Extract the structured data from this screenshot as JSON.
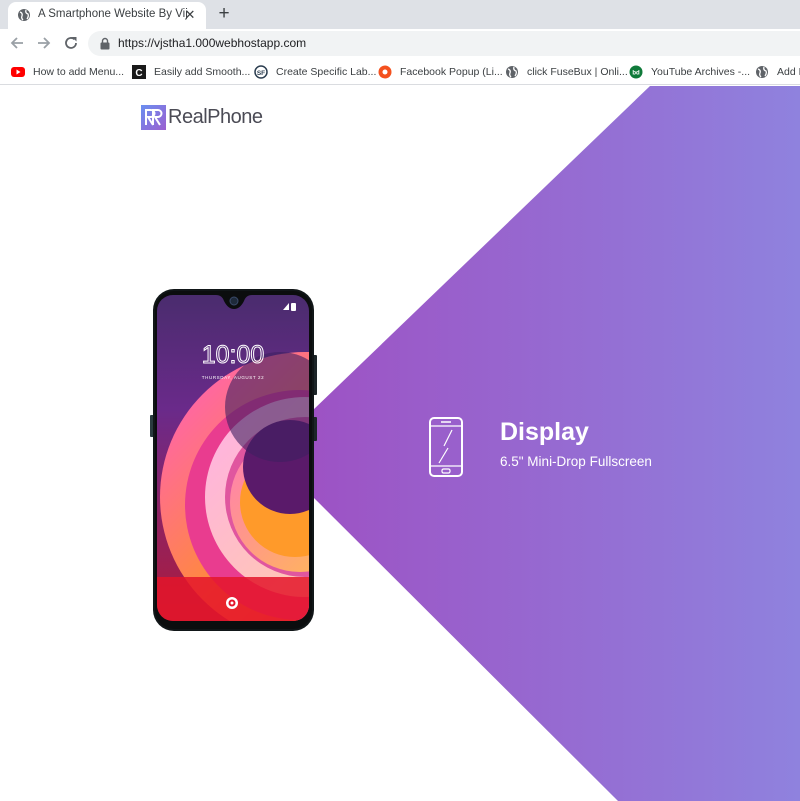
{
  "browser": {
    "tab_title": "A Smartphone Website By Vijay",
    "url": "https://vjstha1.000webhostapp.com",
    "bookmarks": [
      {
        "label": "How to add Menu...",
        "icon": "youtube-icon"
      },
      {
        "label": "Easily add Smooth...",
        "icon": "c-logo-icon"
      },
      {
        "label": "Create Specific Lab...",
        "icon": "sf-logo-icon"
      },
      {
        "label": "Facebook Popup (Li...",
        "icon": "orange-circle-icon"
      },
      {
        "label": "click FuseBux | Onli...",
        "icon": "globe-icon"
      },
      {
        "label": "YouTube Archives -...",
        "icon": "bd-logo-icon"
      },
      {
        "label": "Add E",
        "icon": "globe-icon"
      }
    ]
  },
  "site": {
    "brand": "RealPhone",
    "phone_time": "10:00",
    "phone_date": "THURSDAY, AUGUST 22"
  },
  "feature": {
    "title": "Display",
    "subtitle": "6.5\" Mini-Drop Fullscreen"
  },
  "colors": {
    "accent_start": "#9b59c6",
    "accent_end": "#8e80de",
    "logo_start": "#6a8ff0",
    "logo_end": "#9b5fd0"
  }
}
